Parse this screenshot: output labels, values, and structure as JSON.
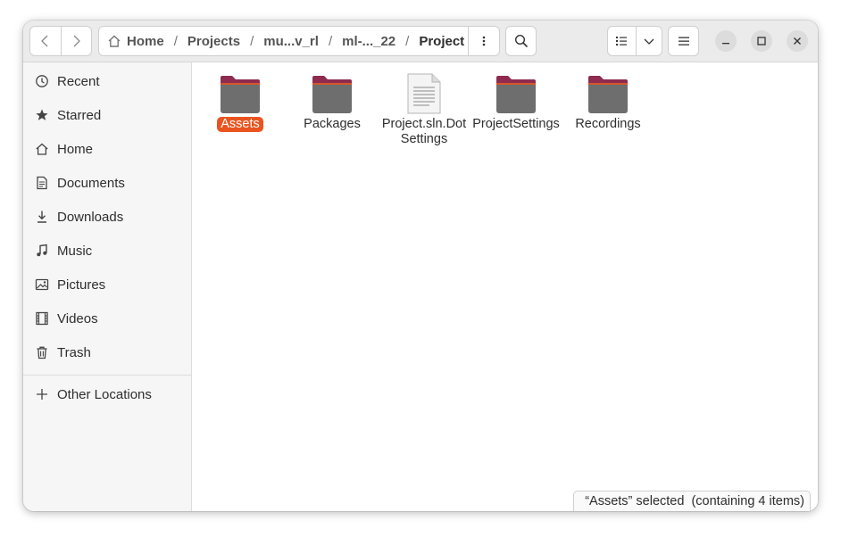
{
  "path": {
    "crumbs": [
      "Home",
      "Projects",
      "mu...v_rl",
      "ml-..._22",
      "Project"
    ],
    "separator": "/"
  },
  "sidebar": {
    "items": [
      {
        "label": "Recent",
        "icon": "clock-icon"
      },
      {
        "label": "Starred",
        "icon": "star-icon"
      },
      {
        "label": "Home",
        "icon": "home-icon"
      },
      {
        "label": "Documents",
        "icon": "document-icon"
      },
      {
        "label": "Downloads",
        "icon": "download-icon"
      },
      {
        "label": "Music",
        "icon": "music-note-icon"
      },
      {
        "label": "Pictures",
        "icon": "picture-icon"
      },
      {
        "label": "Videos",
        "icon": "film-icon"
      },
      {
        "label": "Trash",
        "icon": "trash-icon"
      }
    ],
    "other_locations": {
      "label": "Other Locations",
      "icon": "plus-icon"
    }
  },
  "files": [
    {
      "name": "Assets",
      "type": "folder",
      "selected": true
    },
    {
      "name": "Packages",
      "type": "folder",
      "selected": false
    },
    {
      "name": "Project.sln.DotSettings",
      "type": "file",
      "selected": false
    },
    {
      "name": "ProjectSettings",
      "type": "folder",
      "selected": false
    },
    {
      "name": "Recordings",
      "type": "folder",
      "selected": false
    }
  ],
  "status": {
    "text": "“Assets” selected  (containing 4 items)"
  },
  "colors": {
    "accent": "#e95420",
    "folder_body": "#6e6e6e",
    "folder_tab": "#8e2b4f"
  }
}
